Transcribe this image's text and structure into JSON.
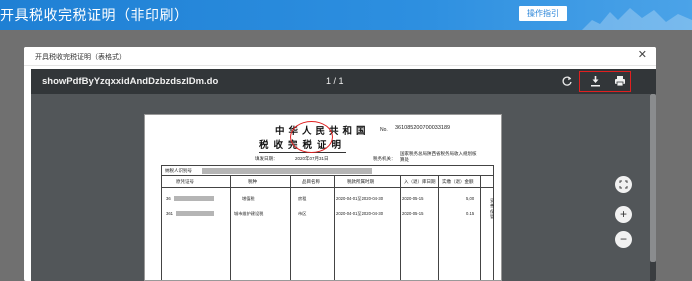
{
  "banner": {
    "title": "开具税收完税证明（非印刷）",
    "guide_label": "操作指引"
  },
  "modal": {
    "title": "开具税收完税证明（表格式）"
  },
  "viewer": {
    "file_name": "showPdfByYzqxxidAndDzbzdszlDm.do",
    "page_indicator": "1 / 1",
    "icons": [
      "rotate-icon",
      "download-icon",
      "print-icon",
      "fit-page-icon",
      "zoom-in-icon",
      "zoom-out-icon"
    ],
    "zoom_in_label": "+",
    "zoom_out_label": "−"
  },
  "document": {
    "title_line1": "中华人民共和国",
    "title_line2": "税收完税证明",
    "no_label": "No.",
    "no_value": "361085200700033189",
    "date_label": "填发日期：",
    "date_value": "2020年07月31日",
    "tax_office_label": "税务机关：",
    "tax_office_value": "国家税务总局陕西省税务局收入规划核算处",
    "taxpayer_label": "纳税人识别号",
    "columns": [
      "原凭证号",
      "税种",
      "品目名称",
      "税款所属时期",
      "入（退）库日期",
      "实缴（退）金额"
    ],
    "rows": [
      {
        "cert": "36",
        "tax": "增值税",
        "item": "房租",
        "period": "2020-04-01至2020-04-30",
        "date": "2020-05-15",
        "amount": "5,00"
      },
      {
        "cert": "361",
        "tax": "城市维护建设税",
        "item": "市区",
        "period": "2020-04-01至2020-04-30",
        "date": "2020-05-15",
        "amount": "0.15"
      }
    ],
    "side_note": "妥善保管"
  },
  "colors": {
    "banner": "#2d8fe0",
    "highlight": "#e02020",
    "toolbar": "#323639",
    "viewer_bg": "#525659"
  }
}
